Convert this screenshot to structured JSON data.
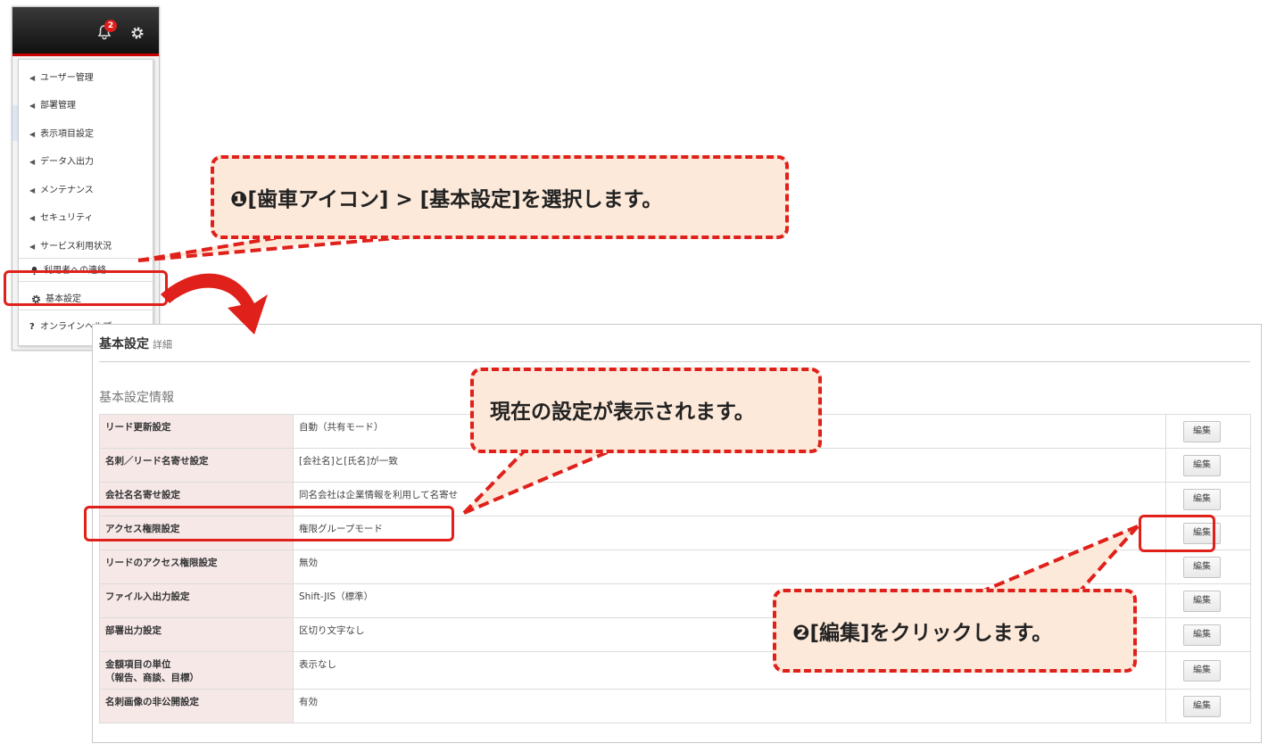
{
  "header": {
    "notification_count": "2"
  },
  "menu": {
    "items": [
      {
        "label": "ユーザー管理"
      },
      {
        "label": "部署管理"
      },
      {
        "label": "表示項目設定"
      },
      {
        "label": "データ入出力"
      },
      {
        "label": "メンテナンス"
      },
      {
        "label": "セキュリティ"
      },
      {
        "label": "サービス利用状況"
      },
      {
        "label": "利用者への連絡"
      },
      {
        "label": "基本設定"
      },
      {
        "label": "オンラインヘルプ"
      }
    ],
    "help_prefix": "?"
  },
  "panel": {
    "title": "基本設定",
    "subtitle": "詳細",
    "section_title": "基本設定情報",
    "edit_label": "編集",
    "rows": [
      {
        "key": "リード更新設定",
        "value": "自動（共有モード）"
      },
      {
        "key": "名刺／リード名寄せ設定",
        "value": "[会社名]と[氏名]が一致"
      },
      {
        "key": "会社名名寄せ設定",
        "value": "同名会社は企業情報を利用して名寄せ"
      },
      {
        "key": "アクセス権限設定",
        "value": "権限グループモード"
      },
      {
        "key": "リードのアクセス権限設定",
        "value": "無効"
      },
      {
        "key": "ファイル入出力設定",
        "value": "Shift-JIS（標準）"
      },
      {
        "key": "部署出力設定",
        "value": "区切り文字なし"
      },
      {
        "key": "金額項目の単位",
        "key2": "（報告、商談、目標）",
        "value": "表示なし"
      },
      {
        "key": "名刺画像の非公開設定",
        "value": "有効"
      }
    ]
  },
  "callouts": {
    "step1": "❶[歯車アイコン] > [基本設定]を選択します。",
    "current": "現在の設定が表示されます。",
    "step2": "❷[編集]をクリックします。"
  },
  "colors": {
    "accent_red": "#e0201a",
    "callout_bg": "#fde9d9",
    "key_cell_bg": "#f7e8e8"
  }
}
